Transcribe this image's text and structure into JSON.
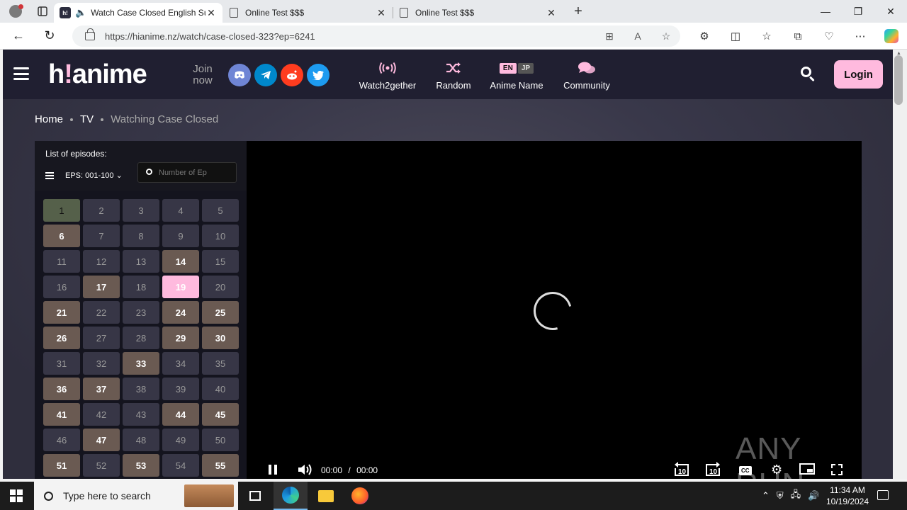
{
  "browser": {
    "tabs": [
      {
        "title": "Watch Case Closed English Sub/Dub online Free on HiAnime.to",
        "favicon": "h!",
        "active": true
      },
      {
        "title": "Online Test $$$",
        "active": false
      },
      {
        "title": "Online Test $$$",
        "active": false
      }
    ],
    "new_tab_label": "+",
    "url": "https://hianime.nz/watch/case-closed-323?ep=6241"
  },
  "site": {
    "logo_main": "h",
    "logo_excl": "!",
    "logo_rest": "anime",
    "join_now": "Join now",
    "socials": [
      {
        "name": "discord",
        "color": "#6f85d5"
      },
      {
        "name": "telegram",
        "color": "#0088cc"
      },
      {
        "name": "reddit",
        "color": "#ff3c1f"
      },
      {
        "name": "twitter",
        "color": "#1d9bf0"
      }
    ],
    "nav": {
      "watch2gether": "Watch2gether",
      "random": "Random",
      "anime_name": "Anime Name",
      "lang_en": "EN",
      "lang_jp": "JP",
      "community": "Community"
    },
    "login": "Login",
    "accent": "#ffbade"
  },
  "breadcrumb": {
    "home": "Home",
    "tv": "TV",
    "current": "Watching Case Closed"
  },
  "episodes": {
    "label": "List of episodes:",
    "range": "EPS: 001-100",
    "search_placeholder": "Number of Ep",
    "current": 19,
    "first_highlight": 1,
    "watched": [
      6,
      14,
      17,
      21,
      24,
      25,
      26,
      29,
      30,
      33,
      36,
      37,
      41,
      44,
      45,
      47,
      51,
      53,
      55
    ],
    "visible_count": 55
  },
  "player": {
    "time_current": "00:00",
    "time_sep": "/",
    "time_total": "00:00",
    "rewind_label": "10",
    "forward_label": "10",
    "cc_label": "CC",
    "watermark": "ANY RUN"
  },
  "taskbar": {
    "search_placeholder": "Type here to search",
    "time": "11:34 AM",
    "date": "10/19/2024"
  }
}
